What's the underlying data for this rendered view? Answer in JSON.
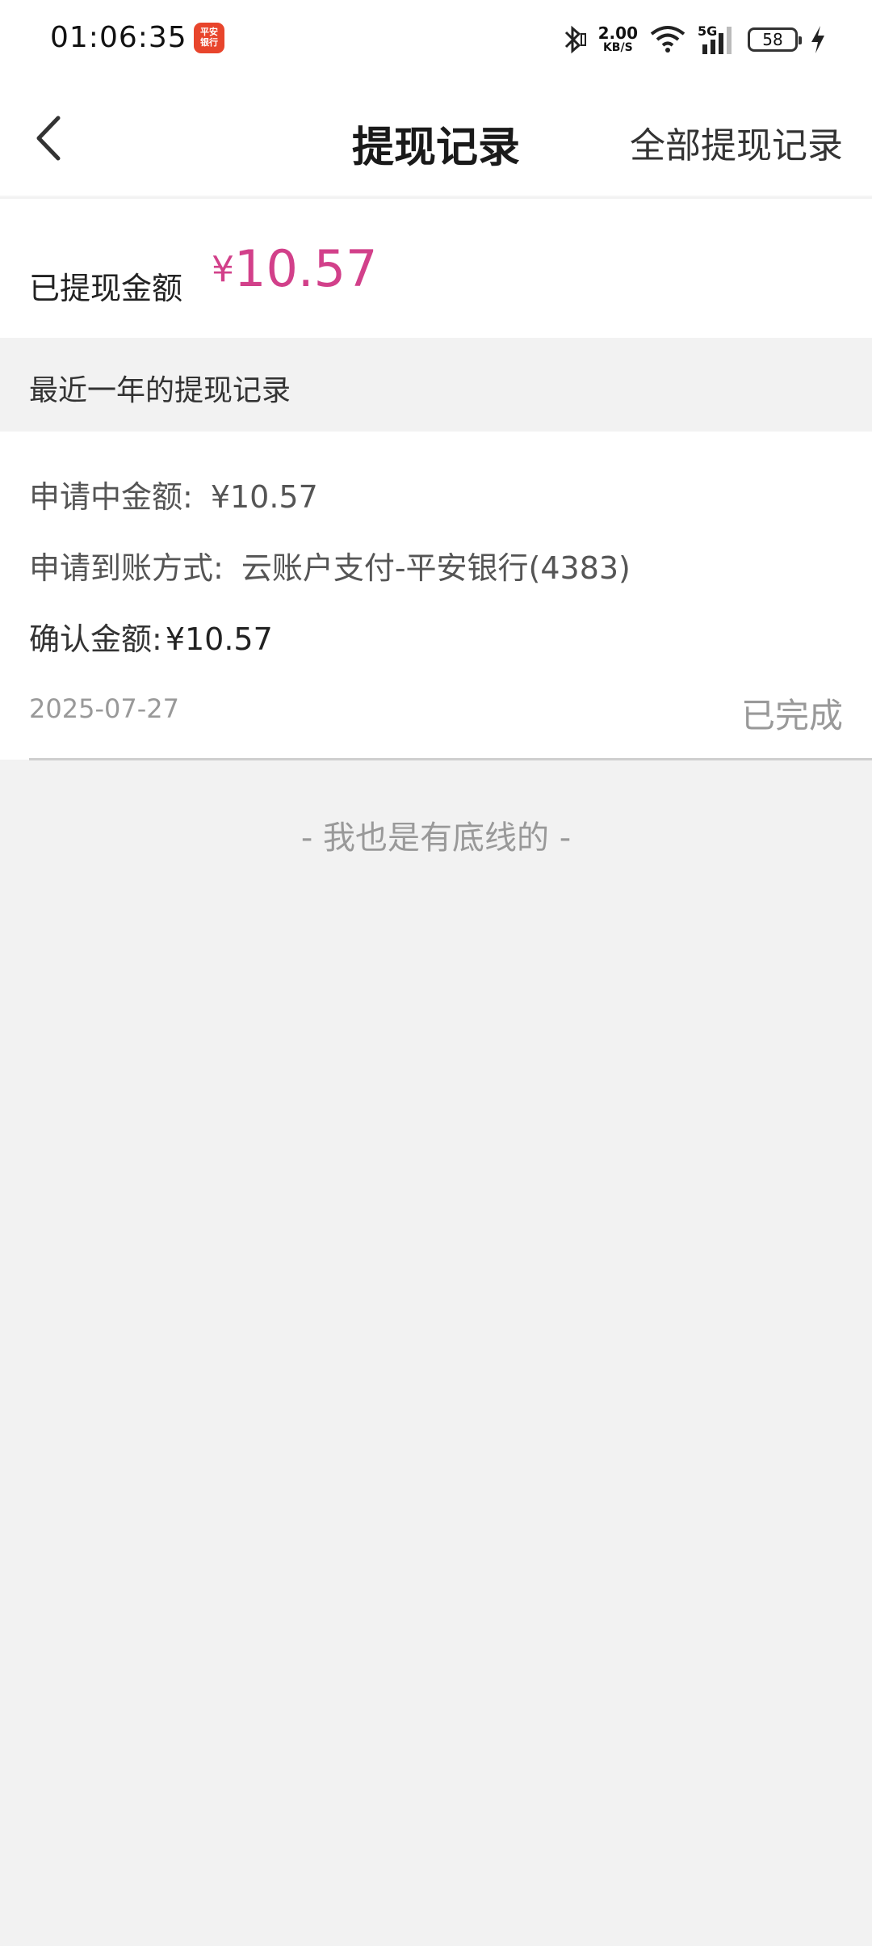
{
  "status_bar": {
    "time": "01:06:35",
    "app_badge_line1": "平安",
    "app_badge_line2": "银行",
    "speed_value": "2.00",
    "speed_unit": "KB/S",
    "network": "5G",
    "battery": "58",
    "icons": [
      "bluetooth-icon",
      "wifi-icon",
      "signal-icon",
      "battery-icon",
      "charging-icon"
    ]
  },
  "nav": {
    "title": "提现记录",
    "right_link": "全部提现记录",
    "back_icon": "chevron-left-icon"
  },
  "summary": {
    "label": "已提现金额",
    "currency": "¥",
    "amount": "10.57",
    "accent_color": "#d2408a"
  },
  "section": {
    "title": "最近一年的提现记录"
  },
  "record": {
    "applying_label": "申请中金额:",
    "applying_value": "¥10.57",
    "method_label": "申请到账方式:",
    "method_value": "云账户支付-平安银行(4383)",
    "confirmed_label": "确认金额:",
    "confirmed_value": "¥10.57",
    "date": "2025-07-27",
    "status": "已完成"
  },
  "footer": {
    "end_text": "- 我也是有底线的 -"
  }
}
